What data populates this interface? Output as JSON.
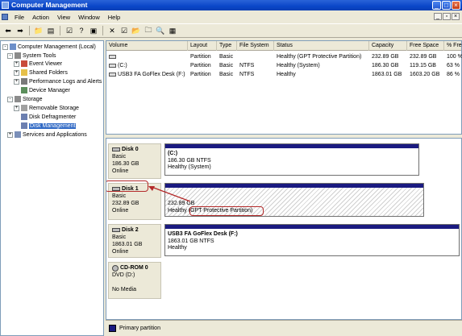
{
  "window": {
    "title": "Computer Management"
  },
  "menu": {
    "items": [
      "File",
      "Action",
      "View",
      "Window",
      "Help"
    ]
  },
  "tree": {
    "items": [
      {
        "label": "Computer Management (Local)",
        "icon": "computer-icon",
        "expander": "-"
      },
      {
        "label": "System Tools",
        "icon": "tools-icon",
        "expander": "-"
      },
      {
        "label": "Event Viewer",
        "icon": "event-viewer-icon",
        "expander": "+"
      },
      {
        "label": "Shared Folders",
        "icon": "shared-folder-icon",
        "expander": "+"
      },
      {
        "label": "Performance Logs and Alerts",
        "icon": "performance-icon",
        "expander": "+"
      },
      {
        "label": "Device Manager",
        "icon": "device-manager-icon",
        "expander": ""
      },
      {
        "label": "Storage",
        "icon": "storage-icon",
        "expander": "-"
      },
      {
        "label": "Removable Storage",
        "icon": "removable-storage-icon",
        "expander": "+"
      },
      {
        "label": "Disk Defragmenter",
        "icon": "defrag-icon",
        "expander": ""
      },
      {
        "label": "Disk Management",
        "icon": "disk-management-icon",
        "expander": "",
        "selected": true
      },
      {
        "label": "Services and Applications",
        "icon": "services-icon",
        "expander": "+"
      }
    ]
  },
  "volumes": {
    "columns": [
      "Volume",
      "Layout",
      "Type",
      "File System",
      "Status",
      "Capacity",
      "Free Space",
      "% Fre"
    ],
    "rows": [
      [
        "",
        "Partition",
        "Basic",
        "",
        "Healthy (GPT Protective Partition)",
        "232.89 GB",
        "232.89 GB",
        "100 %"
      ],
      [
        "(C:)",
        "Partition",
        "Basic",
        "NTFS",
        "Healthy (System)",
        "186.30 GB",
        "119.15 GB",
        "63 %"
      ],
      [
        "USB3 FA GoFlex Desk (F:)",
        "Partition",
        "Basic",
        "NTFS",
        "Healthy",
        "1863.01 GB",
        "1603.20 GB",
        "86 %"
      ]
    ]
  },
  "disks": [
    {
      "name": "Disk 0",
      "type": "Basic",
      "size": "186.30 GB",
      "status": "Online",
      "partition": {
        "title": "(C:)",
        "detail": "186.30 GB NTFS",
        "status": "Healthy (System)"
      }
    },
    {
      "name": "Disk 1",
      "type": "Basic",
      "size": "232.89 GB",
      "status": "Online",
      "partition": {
        "title": "",
        "detail": "232.89 GB",
        "status_prefix": "Healthy",
        "status": "(GPT Protective Partition)"
      }
    },
    {
      "name": "Disk 2",
      "type": "Basic",
      "size": "1863.01 GB",
      "status": "Online",
      "partition": {
        "title": "USB3 FA GoFlex Desk  (F:)",
        "detail": "1863.01 GB NTFS",
        "status": "Healthy"
      }
    },
    {
      "name": "CD-ROM 0",
      "type": "DVD (D:)",
      "size": "",
      "status": "No Media"
    }
  ],
  "legend": {
    "label": "Primary partition",
    "color": "#1a1a80"
  },
  "colors": {
    "titlebar": "#0a46c8",
    "selection": "#316ac5",
    "annotation": "#b42a2a"
  }
}
